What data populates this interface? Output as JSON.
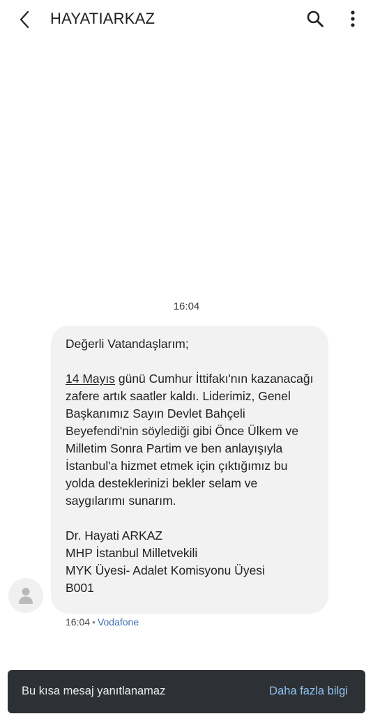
{
  "header": {
    "title": "HAYATIARKAZ",
    "back_icon": "chevron-left-icon",
    "search_icon": "search-icon",
    "more_icon": "more-vertical-icon"
  },
  "conversation": {
    "date_divider": "16:04",
    "message": {
      "greeting": "Değerli Vatandaşlarım;",
      "date_link": "14 Mayıs",
      "body_text": " günü Cumhur İttifakı'nın kazanacağı zafere artık saatler kaldı. Liderimiz, Genel Başkanımız Sayın Devlet Bahçeli Beyefendi'nin söylediği gibi Önce Ülkem ve Milletim Sonra Partim ve ben anlayışıyla İstanbul'a hizmet etmek için çıktığımız bu yolda desteklerinizi bekler selam ve saygılarımı sunarım.",
      "signature_name": "Dr. Hayati ARKAZ",
      "signature_title": "MHP İstanbul Milletvekili",
      "signature_role": "MYK Üyesi- Adalet Komisyonu Üyesi",
      "signature_code": "B001",
      "time": "16:04",
      "separator": "•",
      "carrier": "Vodafone"
    },
    "avatar_icon": "person-icon"
  },
  "snackbar": {
    "text": "Bu kısa mesaj yanıtlanamaz",
    "action": "Daha fazla bilgi"
  },
  "colors": {
    "bubble_bg": "#f2f2f2",
    "snackbar_bg": "#2d3135",
    "snackbar_action": "#8ec1f0",
    "carrier_link": "#3b6fb3"
  }
}
